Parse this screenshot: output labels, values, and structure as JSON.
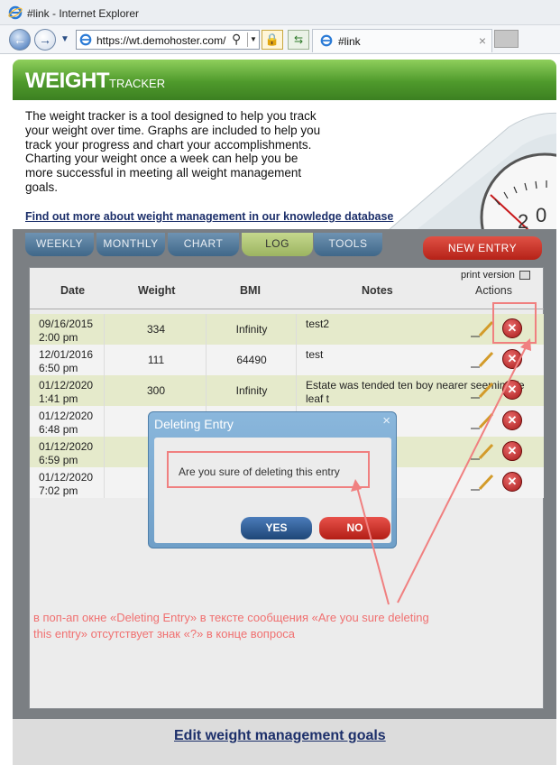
{
  "browser": {
    "window_title": "#link - Internet Explorer",
    "url": "https://wt.demohoster.com/",
    "tab_title": "#link",
    "tab_close": "×"
  },
  "header": {
    "logo_main": "WEIGHT",
    "logo_sub": "TRACKER"
  },
  "intro": {
    "text": "The weight tracker is a tool designed to help you track your weight over time. Graphs are included to help you track your progress and chart your accomplishments. Charting your weight once a week can help you be more successful in meeting all weight management goals.",
    "link": "Find out more about weight management in our knowledge database"
  },
  "tabs": [
    "WEEKLY",
    "MONTHLY",
    "CHART",
    "LOG",
    "TOOLS"
  ],
  "active_tab": "LOG",
  "new_entry_label": "NEW ENTRY",
  "print_version_label": "print version",
  "table": {
    "headers": {
      "date": "Date",
      "weight": "Weight",
      "bmi": "BMI",
      "notes": "Notes",
      "actions": "Actions"
    },
    "rows": [
      {
        "date_line1": "09/16/2015",
        "date_line2": "2:00 pm",
        "weight": "334",
        "bmi": "Infinity",
        "notes_line1": "test2",
        "notes_line2": ""
      },
      {
        "date_line1": "12/01/2016",
        "date_line2": "6:50 pm",
        "weight": "111",
        "bmi": "64490",
        "notes_line1": "test",
        "notes_line2": ""
      },
      {
        "date_line1": "01/12/2020",
        "date_line2": "1:41 pm",
        "weight": "300",
        "bmi": "Infinity",
        "notes_line1": "Estate was tended ten boy nearer seemin We",
        "notes_line2": "leaf t"
      },
      {
        "date_line1": "01/12/2020",
        "date_line2": "6:48 pm",
        "weight": "",
        "bmi": "",
        "notes_line1": "",
        "notes_line2": ""
      },
      {
        "date_line1": "01/12/2020",
        "date_line2": "6:59 pm",
        "weight": "",
        "bmi": "",
        "notes_line1": "",
        "notes_line2": ""
      },
      {
        "date_line1": "01/12/2020",
        "date_line2": "7:02 pm",
        "weight": "",
        "bmi": "",
        "notes_line1": "",
        "notes_line2": ""
      }
    ]
  },
  "footer_link": "Edit weight management goals",
  "modal": {
    "title": "Deleting Entry",
    "close": "×",
    "message": "Are you sure of deleting this entry",
    "yes_label": "YES",
    "no_label": "NO"
  },
  "annotation": {
    "line1": "в поп-ап окне «Deleting Entry» в тексте сообщения «Are you sure deleting",
    "line2": "this entry» отсутствует знак «?» в конце вопроса",
    "color": "#f07070"
  },
  "colors": {
    "header_green": "#4f9a2c",
    "tab_blue": "#3f6789",
    "tab_active": "#9cb461",
    "new_entry_red": "#b52218",
    "modal_blue": "#6f9fc8",
    "link_navy": "#1c2f6a"
  }
}
